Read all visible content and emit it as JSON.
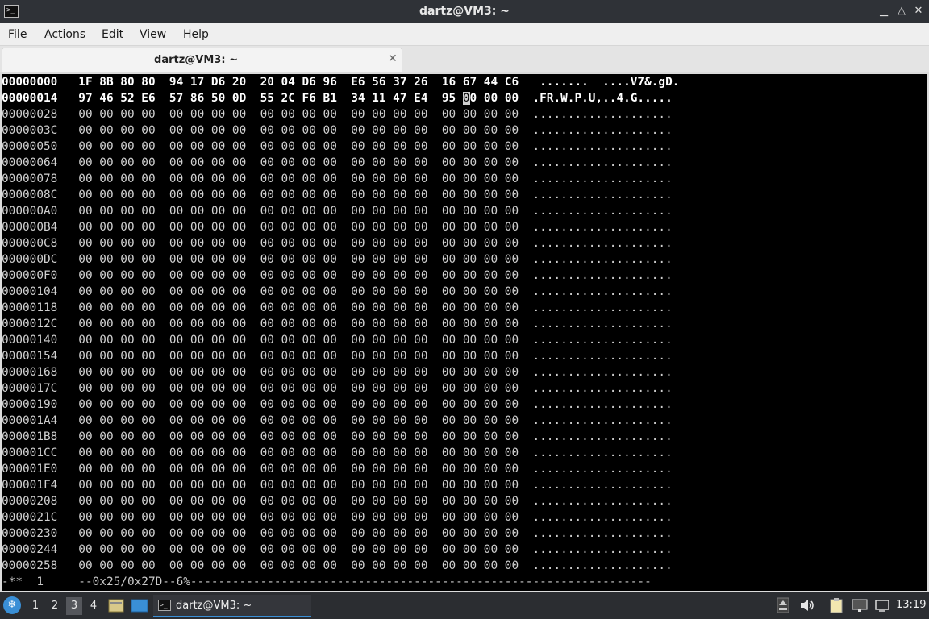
{
  "window": {
    "title": "dartz@VM3: ~",
    "icon": "terminal-icon"
  },
  "menubar": {
    "items": [
      "File",
      "Actions",
      "Edit",
      "View",
      "Help"
    ]
  },
  "tabs": [
    {
      "label": "dartz@VM3: ~",
      "close_icon": "close-icon"
    }
  ],
  "hexdump": {
    "rows": [
      "00000000   1F 8B 80 80  94 17 D6 20  20 04 D6 96  E6 56 37 26  16 67 44 C6   .......  ....V7&.gD.",
      "00000014   97 46 52 E6  57 86 50 0D  55 2C F6 B1  34 11 47 E4  95 00 00 00  .FR.W.P.U,..4.G.....",
      "00000028   00 00 00 00  00 00 00 00  00 00 00 00  00 00 00 00  00 00 00 00  ....................",
      "0000003C   00 00 00 00  00 00 00 00  00 00 00 00  00 00 00 00  00 00 00 00  ....................",
      "00000050   00 00 00 00  00 00 00 00  00 00 00 00  00 00 00 00  00 00 00 00  ....................",
      "00000064   00 00 00 00  00 00 00 00  00 00 00 00  00 00 00 00  00 00 00 00  ....................",
      "00000078   00 00 00 00  00 00 00 00  00 00 00 00  00 00 00 00  00 00 00 00  ....................",
      "0000008C   00 00 00 00  00 00 00 00  00 00 00 00  00 00 00 00  00 00 00 00  ....................",
      "000000A0   00 00 00 00  00 00 00 00  00 00 00 00  00 00 00 00  00 00 00 00  ....................",
      "000000B4   00 00 00 00  00 00 00 00  00 00 00 00  00 00 00 00  00 00 00 00  ....................",
      "000000C8   00 00 00 00  00 00 00 00  00 00 00 00  00 00 00 00  00 00 00 00  ....................",
      "000000DC   00 00 00 00  00 00 00 00  00 00 00 00  00 00 00 00  00 00 00 00  ....................",
      "000000F0   00 00 00 00  00 00 00 00  00 00 00 00  00 00 00 00  00 00 00 00  ....................",
      "00000104   00 00 00 00  00 00 00 00  00 00 00 00  00 00 00 00  00 00 00 00  ....................",
      "00000118   00 00 00 00  00 00 00 00  00 00 00 00  00 00 00 00  00 00 00 00  ....................",
      "0000012C   00 00 00 00  00 00 00 00  00 00 00 00  00 00 00 00  00 00 00 00  ....................",
      "00000140   00 00 00 00  00 00 00 00  00 00 00 00  00 00 00 00  00 00 00 00  ....................",
      "00000154   00 00 00 00  00 00 00 00  00 00 00 00  00 00 00 00  00 00 00 00  ....................",
      "00000168   00 00 00 00  00 00 00 00  00 00 00 00  00 00 00 00  00 00 00 00  ....................",
      "0000017C   00 00 00 00  00 00 00 00  00 00 00 00  00 00 00 00  00 00 00 00  ....................",
      "00000190   00 00 00 00  00 00 00 00  00 00 00 00  00 00 00 00  00 00 00 00  ....................",
      "000001A4   00 00 00 00  00 00 00 00  00 00 00 00  00 00 00 00  00 00 00 00  ....................",
      "000001B8   00 00 00 00  00 00 00 00  00 00 00 00  00 00 00 00  00 00 00 00  ....................",
      "000001CC   00 00 00 00  00 00 00 00  00 00 00 00  00 00 00 00  00 00 00 00  ....................",
      "000001E0   00 00 00 00  00 00 00 00  00 00 00 00  00 00 00 00  00 00 00 00  ....................",
      "000001F4   00 00 00 00  00 00 00 00  00 00 00 00  00 00 00 00  00 00 00 00  ....................",
      "00000208   00 00 00 00  00 00 00 00  00 00 00 00  00 00 00 00  00 00 00 00  ....................",
      "0000021C   00 00 00 00  00 00 00 00  00 00 00 00  00 00 00 00  00 00 00 00  ....................",
      "00000230   00 00 00 00  00 00 00 00  00 00 00 00  00 00 00 00  00 00 00 00  ....................",
      "00000244   00 00 00 00  00 00 00 00  00 00 00 00  00 00 00 00  00 00 00 00  ....................",
      "00000258   00 00 00 00  00 00 00 00  00 00 00 00  00 00 00 00  00 00 00 00  ...................."
    ],
    "status_line": "-**  1     --0x25/0x27D--6%------------------------------------------------------------------"
  },
  "taskbar": {
    "workspaces": [
      "1",
      "2",
      "3",
      "4"
    ],
    "active_workspace": "3",
    "task_label": "dartz@VM3: ~",
    "clock": "13:19"
  },
  "colors": {
    "terminal_bg": "#000000",
    "terminal_fg": "#d0d0d0",
    "taskbar_bg": "#2b2d31",
    "accent": "#3a8fd6"
  }
}
